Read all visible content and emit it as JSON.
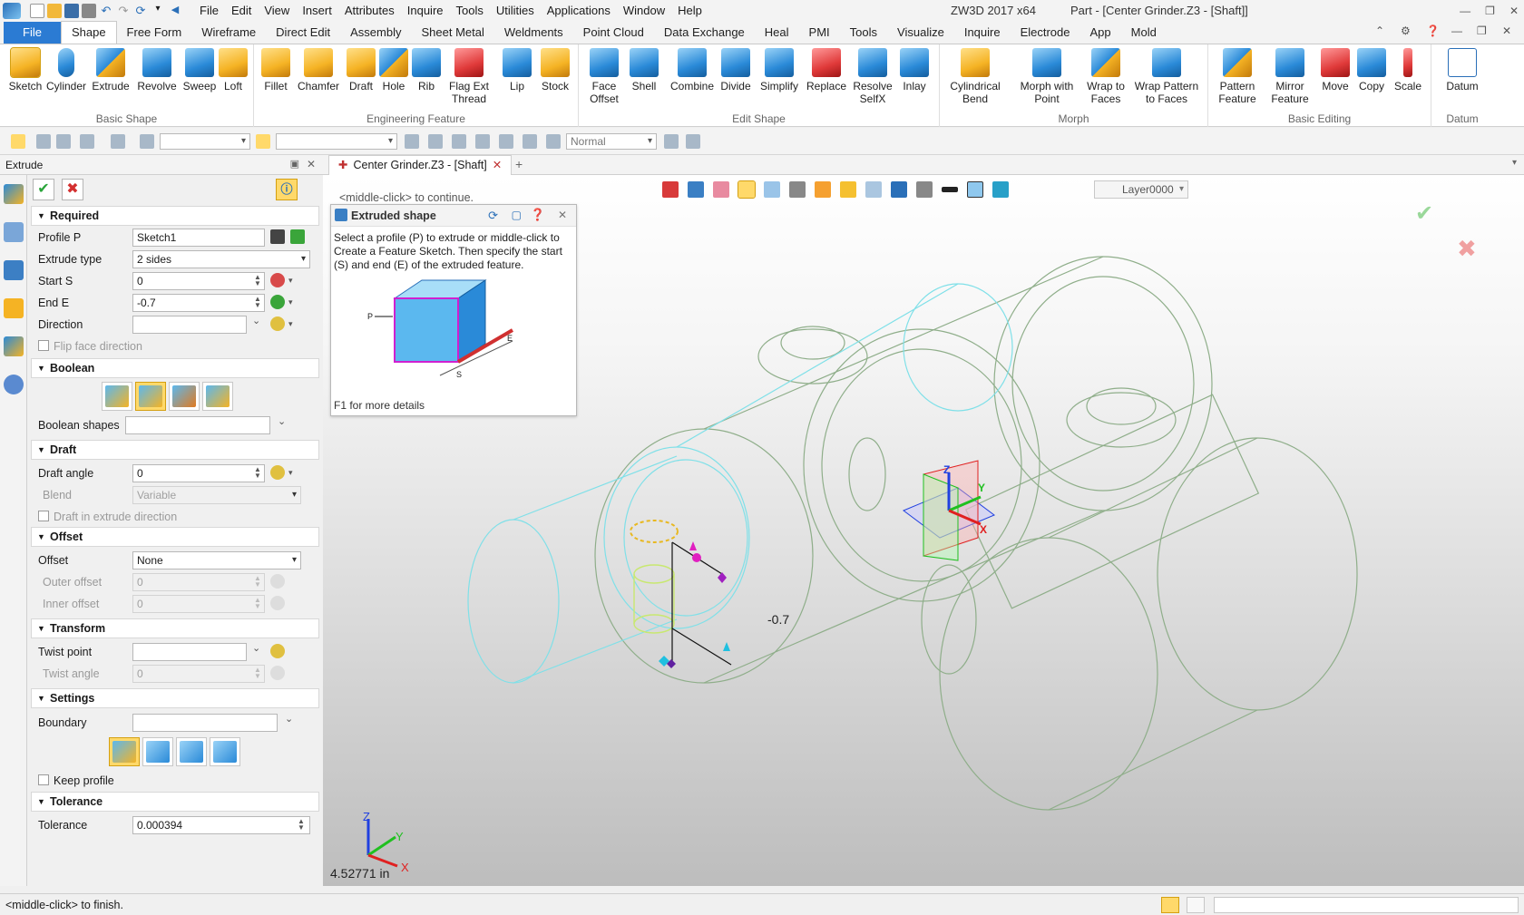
{
  "titlebar": {
    "menu": [
      "File",
      "Edit",
      "View",
      "Insert",
      "Attributes",
      "Inquire",
      "Tools",
      "Utilities",
      "Applications",
      "Window",
      "Help"
    ],
    "app_version": "ZW3D 2017  x64",
    "document_title": "Part - [Center Grinder.Z3 - [Shaft]]"
  },
  "ribbon_tabs": [
    "File",
    "Shape",
    "Free Form",
    "Wireframe",
    "Direct Edit",
    "Assembly",
    "Sheet Metal",
    "Weldments",
    "Point Cloud",
    "Data Exchange",
    "Heal",
    "PMI",
    "Tools",
    "Visualize",
    "Inquire",
    "Electrode",
    "App",
    "Mold"
  ],
  "ribbon_groups": {
    "basic_shape": {
      "label": "Basic Shape",
      "buttons": [
        "Sketch",
        "Cylinder",
        "Extrude",
        "Revolve",
        "Sweep",
        "Loft"
      ]
    },
    "engineering_feature": {
      "label": "Engineering Feature",
      "buttons": [
        "Fillet",
        "Chamfer",
        "Draft",
        "Hole",
        "Rib",
        "Flag Ext Thread",
        "Lip",
        "Stock"
      ]
    },
    "edit_shape": {
      "label": "Edit Shape",
      "buttons": [
        "Face Offset",
        "Shell",
        "Combine",
        "Divide",
        "Simplify",
        "Replace",
        "Resolve SelfX",
        "Inlay"
      ]
    },
    "morph": {
      "label": "Morph",
      "buttons": [
        "Cylindrical Bend",
        "Morph with Point",
        "Wrap to Faces",
        "Wrap Pattern to Faces"
      ]
    },
    "basic_editing": {
      "label": "Basic Editing",
      "buttons": [
        "Pattern Feature",
        "Mirror Feature",
        "Move",
        "Copy",
        "Scale"
      ]
    },
    "datum": {
      "label": "Datum",
      "buttons": [
        "Datum"
      ]
    }
  },
  "toolbar2": {
    "render_mode": "Normal"
  },
  "panel": {
    "title": "Extrude",
    "sections": {
      "required": "Required",
      "boolean": "Boolean",
      "draft": "Draft",
      "offset": "Offset",
      "transform": "Transform",
      "settings": "Settings",
      "tolerance": "Tolerance"
    },
    "required": {
      "profile_label": "Profile P",
      "profile_value": "Sketch1",
      "extrude_type_label": "Extrude type",
      "extrude_type_value": "2 sides",
      "start_label": "Start S",
      "start_value": "0",
      "end_label": "End E",
      "end_value": "-0.7",
      "direction_label": "Direction",
      "flip_label": "Flip face direction"
    },
    "boolean": {
      "shapes_label": "Boolean shapes"
    },
    "draft": {
      "angle_label": "Draft angle",
      "angle_value": "0",
      "blend_label": "Blend",
      "blend_value": "Variable",
      "in_dir_label": "Draft in extrude direction"
    },
    "offset": {
      "offset_label": "Offset",
      "offset_value": "None",
      "outer_label": "Outer offset",
      "outer_value": "0",
      "inner_label": "Inner offset",
      "inner_value": "0"
    },
    "transform": {
      "twist_point_label": "Twist point",
      "twist_angle_label": "Twist angle",
      "twist_angle_value": "0"
    },
    "settings": {
      "boundary_label": "Boundary",
      "keep_profile_label": "Keep profile"
    },
    "tolerance": {
      "label": "Tolerance",
      "value": "0.000394"
    }
  },
  "document_tab": {
    "label": "Center Grinder.Z3 - [Shaft]"
  },
  "viewport": {
    "hint_top": "<middle-click> to continue.",
    "help_box": {
      "title": "Extruded shape",
      "text": "Select a profile (P) to extrude or middle-click to Create a Feature Sketch. Then specify the start (S) and end (E) of the extruded feature.",
      "footer": "F1 for more details",
      "labels": [
        "P",
        "E",
        "S"
      ]
    },
    "layer": "Layer0000",
    "dimension": "-0.7",
    "measure": "4.52771 in",
    "axis_labels": [
      "Z",
      "Y",
      "X"
    ]
  },
  "statusbar": {
    "message": "<middle-click> to finish."
  },
  "colors": {
    "accent": "#2b7bd3",
    "wire_green": "#8fae8a",
    "wire_cyan": "#7fe0e8",
    "highlight": "#ffd96a"
  }
}
